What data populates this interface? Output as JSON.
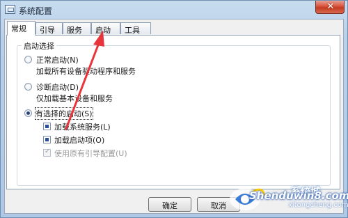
{
  "window": {
    "title": "系统配置",
    "close_glyph": "✕"
  },
  "tabs": [
    {
      "label": "常规"
    },
    {
      "label": "引导"
    },
    {
      "label": "服务"
    },
    {
      "label": "启动"
    },
    {
      "label": "工具"
    }
  ],
  "startup": {
    "group_title": "启动选择",
    "normal": {
      "label": "正常启动(N)",
      "desc": "加载所有设备驱动程序和服务"
    },
    "diagnostic": {
      "label": "诊断启动(D)",
      "desc": "仅加载基本设备和服务"
    },
    "selective": {
      "label": "有选择的启动(S)",
      "options": [
        {
          "label": "加载系统服务(L)",
          "checked": true
        },
        {
          "label": "加载启动项(O)",
          "checked": true
        },
        {
          "label": "使用原有引导配置(U)",
          "checked": true,
          "disabled": true
        }
      ]
    }
  },
  "buttons": {
    "ok": "确定",
    "cancel": "取消"
  },
  "watermark": {
    "brand": "系统城",
    "site": "Shenduwin8.com",
    "domain": "xitongcheng.com"
  },
  "colors": {
    "arrow": "#e8343a",
    "close": "#d8533d"
  }
}
